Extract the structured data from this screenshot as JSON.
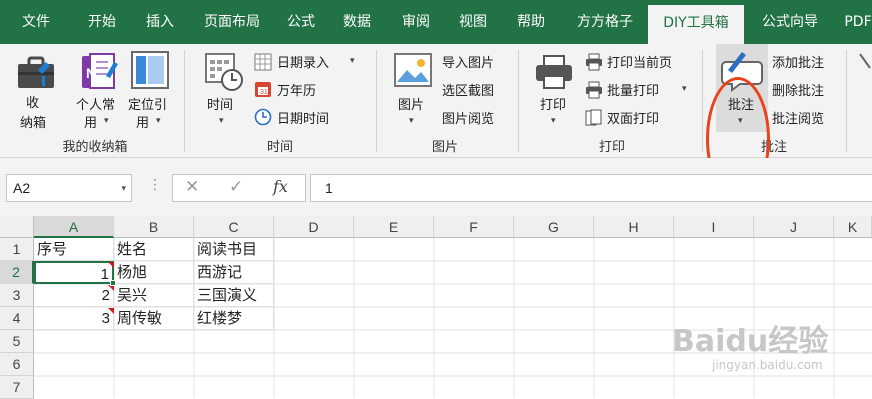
{
  "tabs": [
    "文件",
    "开始",
    "插入",
    "页面布局",
    "公式",
    "数据",
    "审阅",
    "视图",
    "帮助",
    "方方格子",
    "DIY工具箱",
    "公式向导",
    "PDF"
  ],
  "active_tab": "DIY工具箱",
  "ribbon": {
    "groups": {
      "shounaxiang": {
        "label": "我的收纳箱",
        "shounaxiang_btn": [
          "收",
          "纳箱"
        ],
        "personal_btn": [
          "个人常",
          "用"
        ],
        "position_btn": [
          "定位引",
          "用"
        ]
      },
      "time": {
        "label": "时间",
        "time_btn": "时间",
        "date_entry": "日期录入",
        "calendar": "万年历",
        "date_time": "日期时间"
      },
      "picture": {
        "label": "图片",
        "picture_btn": "图片",
        "import_pic": "导入图片",
        "region_capture": "选区截图",
        "pic_browse": "图片阅览"
      },
      "print": {
        "label": "打印",
        "print_btn": "打印",
        "print_current": "打印当前页",
        "batch_print": "批量打印",
        "duplex_print": "双面打印"
      },
      "comment": {
        "label": "批注",
        "comment_btn": "批注",
        "add_comment": "添加批注",
        "delete_comment": "删除批注",
        "browse_comment": "批注阅览"
      }
    }
  },
  "formula_bar": {
    "name_box": "A2",
    "cancel_icon": "✕",
    "enter_icon": "✓",
    "fx_label": "fx",
    "value": "1"
  },
  "columns": [
    "A",
    "B",
    "C",
    "D",
    "E",
    "F",
    "G",
    "H",
    "I",
    "J",
    "K"
  ],
  "rows": [
    "1",
    "2",
    "3",
    "4",
    "5",
    "6",
    "7"
  ],
  "cells": {
    "A1": "序号",
    "B1": "姓名",
    "C1": "阅读书目",
    "A2": "1",
    "B2": "杨旭",
    "C2": "西游记",
    "A3": "2",
    "B3": "吴兴",
    "C3": "三国演义",
    "A4": "3",
    "B4": "周传敏",
    "C4": "红楼梦"
  },
  "watermark": {
    "brand": "Baidu经验",
    "url": "jingyan.baidu.com"
  },
  "colors": {
    "excel_green": "#217346",
    "highlight_circle": "#e8431c",
    "comment_marker": "#d21a1a"
  }
}
